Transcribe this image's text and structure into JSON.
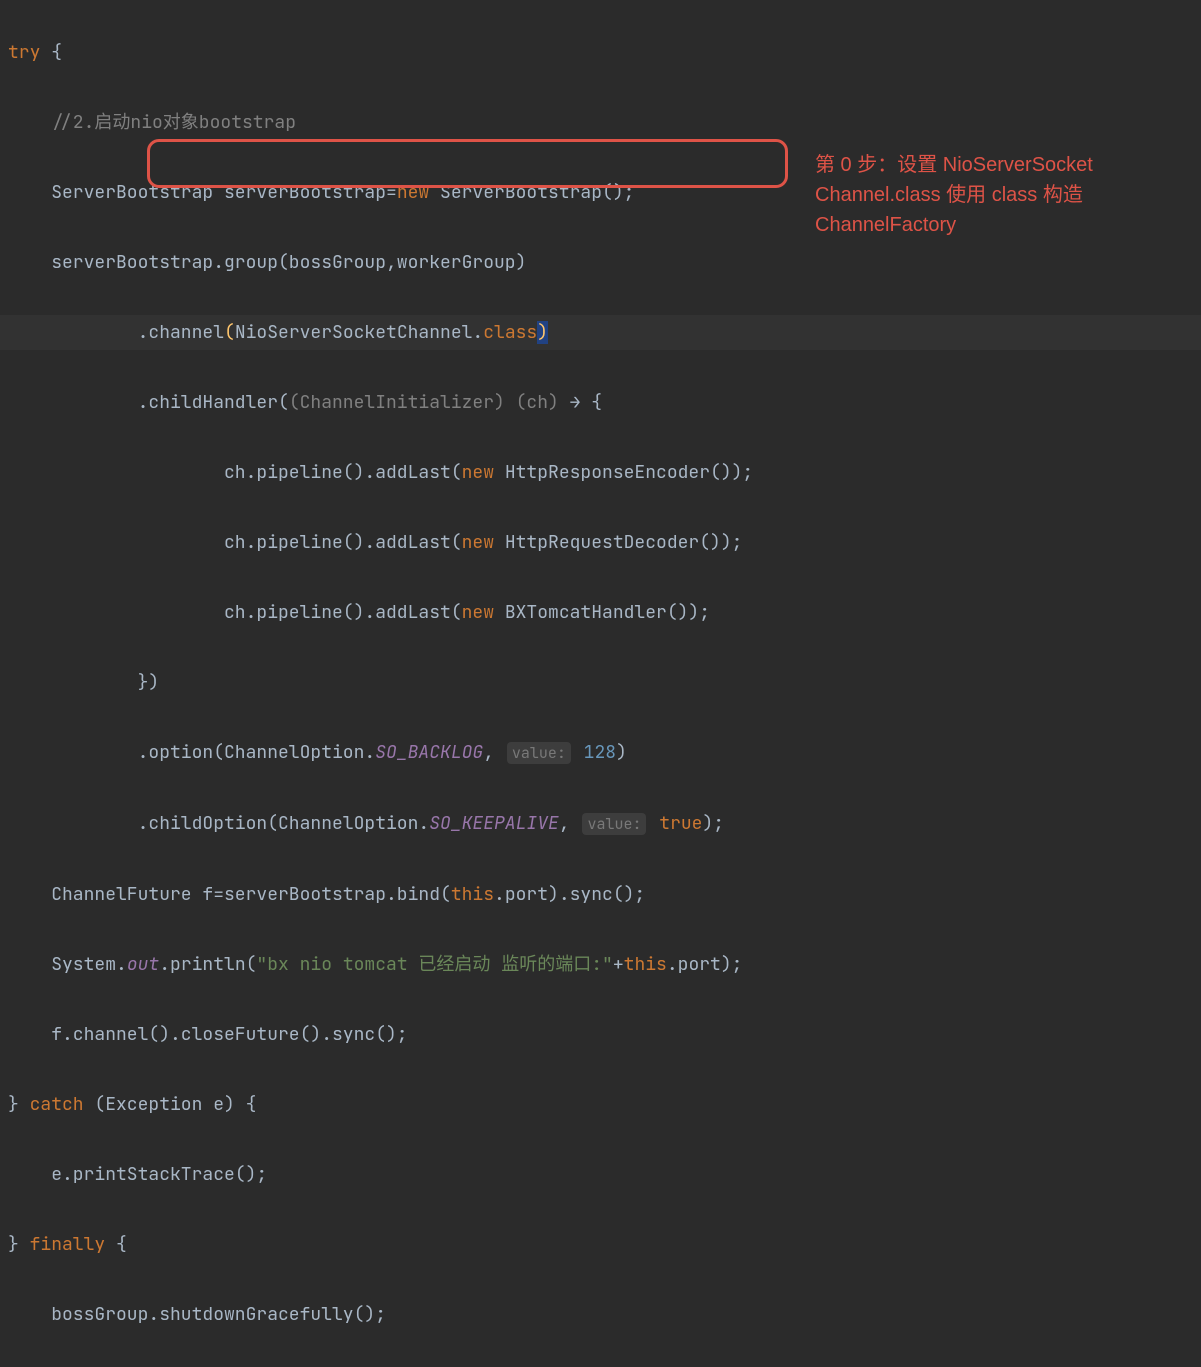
{
  "code": {
    "try": "try",
    "brace_open": " {",
    "comment": "//2.启动nio对象bootstrap",
    "l3_a": "ServerBootstrap serverBootstrap=",
    "l3_new": "new",
    "l3_b": " ServerBootstrap();",
    "l4": "serverBootstrap.group(bossGroup,workerGroup)",
    "l5_a": ".channel",
    "l5_p1": "(",
    "l5_b": "NioServerSocketChannel.",
    "l5_class": "class",
    "l5_p2": ")",
    "l6_a": ".childHandler(",
    "l6_hint1": "(ChannelInitializer) ",
    "l6_hint2": "(ch)",
    "l6_arrow": " → {",
    "l7_a": "ch.pipeline().addLast(",
    "l7_new": "new",
    "l7_b": " HttpResponseEncoder());",
    "l8_a": "ch.pipeline().addLast(",
    "l8_new": "new",
    "l8_b": " HttpRequestDecoder());",
    "l9_a": "ch.pipeline().addLast(",
    "l9_new": "new",
    "l9_b": " BXTomcatHandler());",
    "l10": "})",
    "l11_a": ".option(ChannelOption.",
    "l11_b": "SO_BACKLOG",
    "l11_c": ",",
    "l11_hint": "value:",
    "l11_num": " 128",
    "l11_d": ")",
    "l12_a": ".childOption(ChannelOption.",
    "l12_b": "SO_KEEPALIVE",
    "l12_c": ",",
    "l12_hint": "value:",
    "l12_true": " true",
    "l12_d": ");",
    "l13_a": "ChannelFuture f=serverBootstrap.bind(",
    "l13_this": "this",
    "l13_b": ".port).sync();",
    "l14_a": "System.",
    "l14_out": "out",
    "l14_b": ".println(",
    "l14_str": "\"bx nio tomcat 已经启动 监听的端口:\"",
    "l14_c": "+",
    "l14_this": "this",
    "l14_d": ".port);",
    "l15": "f.channel().closeFuture().sync();",
    "l16_a": "} ",
    "l16_catch": "catch",
    "l16_b": " (Exception e) {",
    "l17": "e.printStackTrace();",
    "l18_a": "} ",
    "l18_finally": "finally",
    "l18_b": " {",
    "l19": "bossGroup.shutdownGracefully();"
  },
  "annotation": {
    "text1": "第 0 步：设置 NioServerSocket",
    "text2": "Channel.class 使用 class 构造",
    "text3": "ChannelFactory"
  }
}
